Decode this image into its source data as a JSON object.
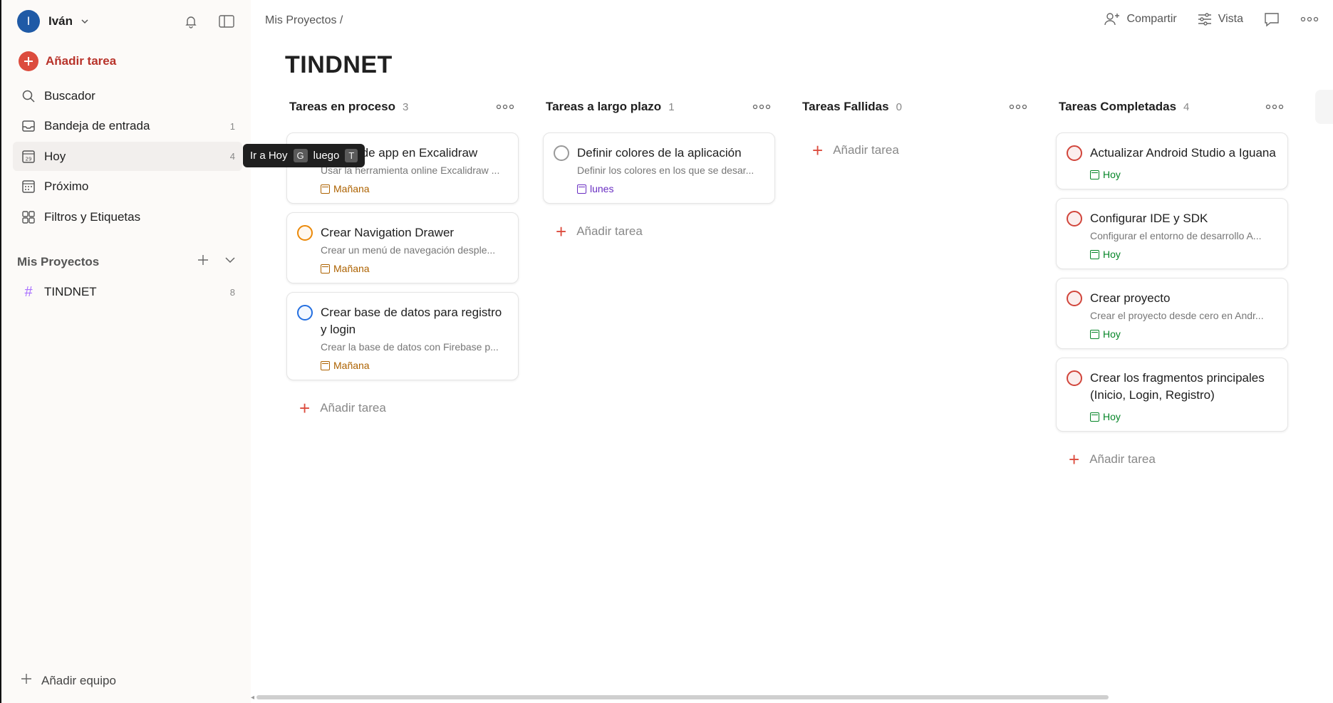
{
  "user": {
    "initial": "I",
    "name": "Iván"
  },
  "sidebar": {
    "add_task": "Añadir tarea",
    "items": [
      {
        "label": "Buscador",
        "icon": "search-icon",
        "count": ""
      },
      {
        "label": "Bandeja de entrada",
        "icon": "inbox-icon",
        "count": "1"
      },
      {
        "label": "Hoy",
        "icon": "calendar-today-icon",
        "count": "4",
        "active": true
      },
      {
        "label": "Próximo",
        "icon": "calendar-grid-icon",
        "count": ""
      },
      {
        "label": "Filtros y Etiquetas",
        "icon": "filters-icon",
        "count": ""
      }
    ],
    "projects_label": "Mis Proyectos",
    "project": {
      "name": "TINDNET",
      "count": "8"
    },
    "add_team": "Añadir equipo"
  },
  "tooltip": {
    "text": "Ir a Hoy",
    "key1": "G",
    "mid": "luego",
    "key2": "T"
  },
  "header": {
    "breadcrumb": "Mis Proyectos /",
    "share": "Compartir",
    "view": "Vista",
    "title": "TINDNET"
  },
  "colors": {
    "accent": "#dc4c3e",
    "sidebar_bg": "#fcfaf8"
  },
  "columns": [
    {
      "title": "Tareas en proceso",
      "count": "3",
      "cards": [
        {
          "title": "Boceto de app en Excalidraw",
          "desc": "Usar la herramienta online Excalidraw ...",
          "date": "Mañana",
          "date_color": "orange",
          "check": "grey"
        },
        {
          "title": "Crear Navigation Drawer",
          "desc": "Crear un menú de navegación desple...",
          "date": "Mañana",
          "date_color": "orange",
          "check": "orange"
        },
        {
          "title": "Crear base de datos para registro y login",
          "desc": "Crear la base de datos con Firebase p...",
          "date": "Mañana",
          "date_color": "orange",
          "check": "blue"
        }
      ],
      "add": "Añadir tarea"
    },
    {
      "title": "Tareas a largo plazo",
      "count": "1",
      "cards": [
        {
          "title": "Definir colores de la aplicación",
          "desc": "Definir los colores en los que se desar...",
          "date": "lunes",
          "date_color": "purple",
          "check": "grey"
        }
      ],
      "add": "Añadir tarea"
    },
    {
      "title": "Tareas Fallidas",
      "count": "0",
      "cards": [],
      "add": "Añadir tarea"
    },
    {
      "title": "Tareas Completadas",
      "count": "4",
      "cards": [
        {
          "title": "Actualizar Android Studio a Iguana",
          "desc": "",
          "date": "Hoy",
          "date_color": "green",
          "check": "red"
        },
        {
          "title": "Configurar IDE y SDK",
          "desc": "Configurar el entorno de desarrollo A...",
          "date": "Hoy",
          "date_color": "green",
          "check": "red"
        },
        {
          "title": "Crear proyecto",
          "desc": "Crear el proyecto desde cero en Andr...",
          "date": "Hoy",
          "date_color": "green",
          "check": "red"
        },
        {
          "title": "Crear los fragmentos principales (Inicio, Login, Registro)",
          "desc": "",
          "date": "Hoy",
          "date_color": "green",
          "check": "red"
        }
      ],
      "add": "Añadir tarea"
    }
  ]
}
